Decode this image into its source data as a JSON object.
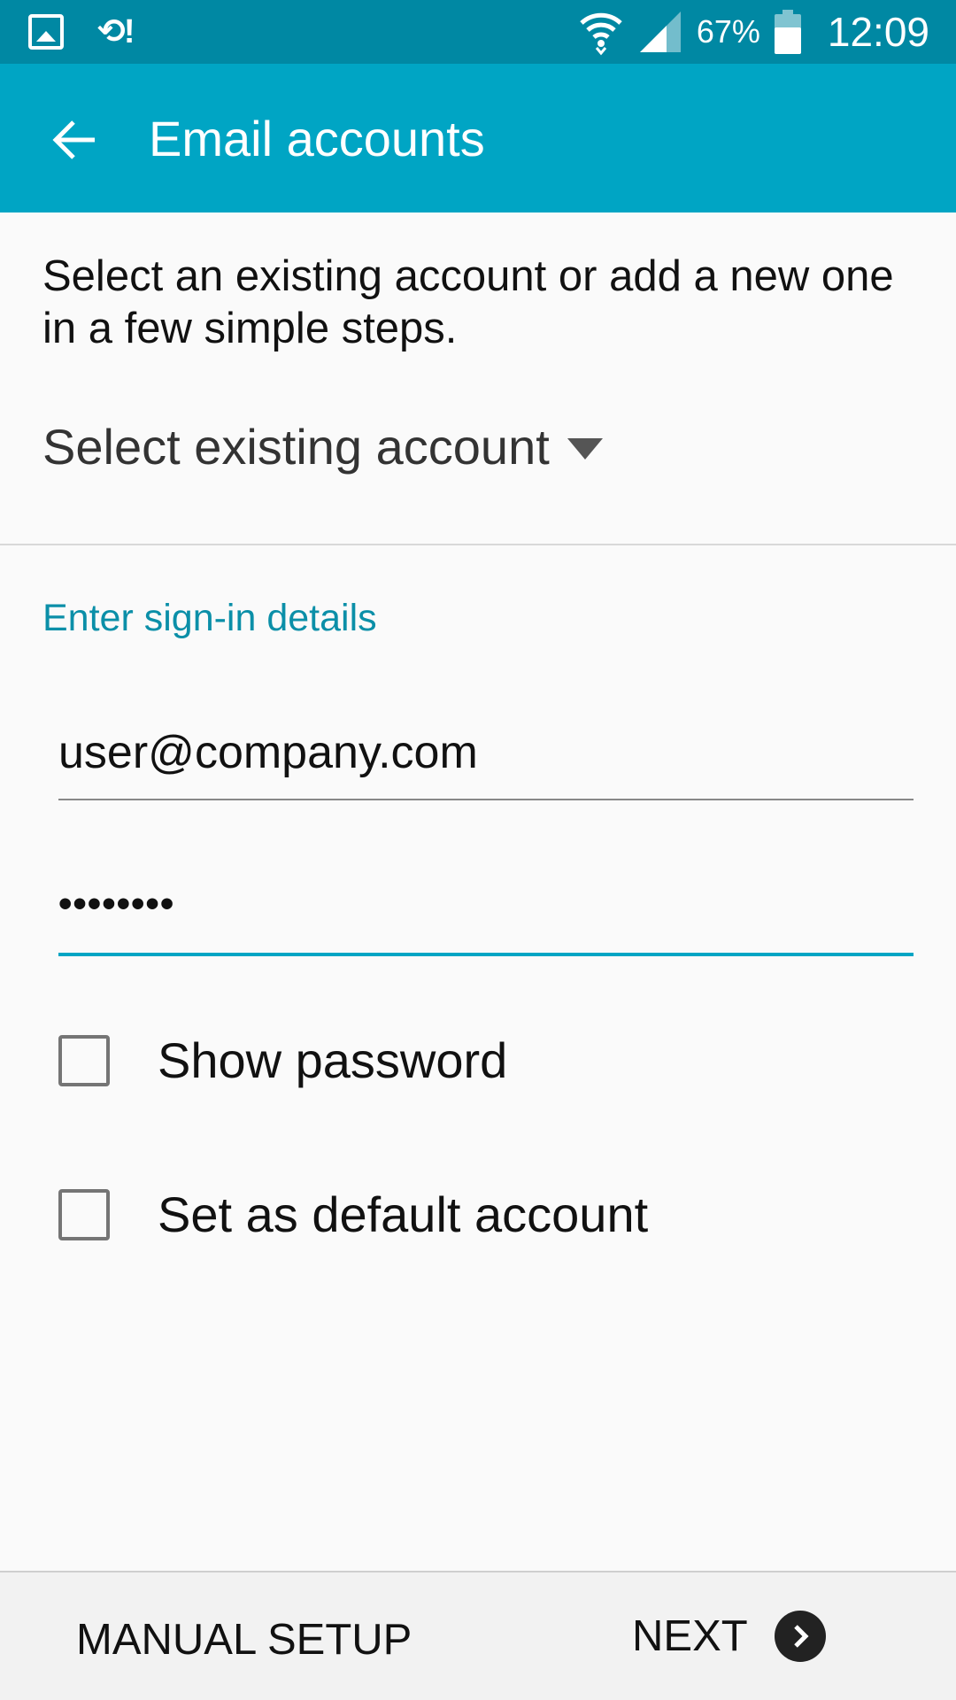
{
  "status_bar": {
    "icons_left": [
      "gallery-icon",
      "sync-icon"
    ],
    "sync_glyph": "⟲!",
    "battery_percent": "67%",
    "time": "12:09",
    "icons_right": [
      "wifi-icon",
      "signal-icon",
      "battery-icon"
    ]
  },
  "app_bar": {
    "title": "Email accounts",
    "back_icon": "arrow-back-icon",
    "background": "#00a5c4"
  },
  "content": {
    "intro": "Select an existing account or add a new one in a few simple steps.",
    "select_existing": "Select existing account",
    "section_label": "Enter sign-in details",
    "email_value": "user@company.com",
    "password_value": "••••••••",
    "show_password_label": "Show password",
    "show_password_checked": false,
    "default_account_label": "Set as default account",
    "default_account_checked": false,
    "accent": "#0b8fa8"
  },
  "bottom_bar": {
    "manual_setup": "MANUAL SETUP",
    "next": "NEXT",
    "next_icon": "chevron-right-circle-icon"
  }
}
